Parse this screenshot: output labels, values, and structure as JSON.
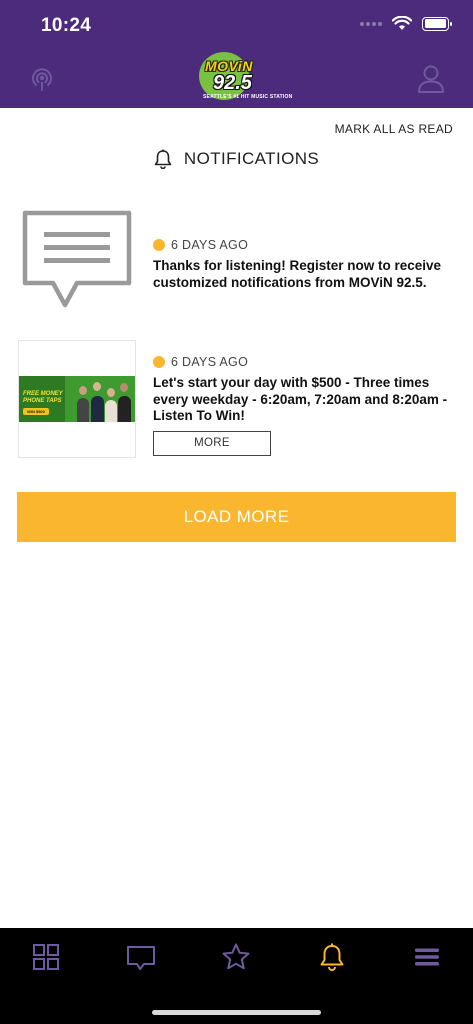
{
  "status_bar": {
    "time": "10:24"
  },
  "header": {
    "logo": {
      "name": "MOViN",
      "frequency": "92.5",
      "tagline": "SEATTLE'S #1 HIT MUSIC STATION"
    },
    "left_icon": "podcast-icon",
    "right_icon": "profile-icon"
  },
  "page": {
    "mark_all_label": "MARK ALL AS READ",
    "title": "NOTIFICATIONS",
    "title_icon": "bell-icon"
  },
  "notifications": [
    {
      "time": "6 DAYS AGO",
      "text": "Thanks for listening! Register now to receive customized notifications from MOViN 92.5.",
      "thumbnail": "message-icon"
    },
    {
      "time": "6 DAYS AGO",
      "text": "Let's start your day with $500 - Three times every weekday - 6:20am, 7:20am and 8:20am - Listen To Win!",
      "thumbnail": "promo-banner",
      "banner": {
        "line1": "FREE MONEY",
        "line2": "PHONE TAPS",
        "badge": "WIN $500"
      },
      "more_label": "MORE"
    }
  ],
  "load_more_label": "LOAD MORE",
  "tabbar": {
    "items": [
      {
        "icon": "grid-icon",
        "active": false
      },
      {
        "icon": "chat-icon",
        "active": false
      },
      {
        "icon": "star-icon",
        "active": false
      },
      {
        "icon": "bell-icon",
        "active": true
      },
      {
        "icon": "menu-icon",
        "active": false
      }
    ]
  },
  "colors": {
    "header_bg": "#4c2a7c",
    "accent": "#fbb62f",
    "tab_inactive": "#6e5a9c",
    "tabbar_bg": "#000000"
  }
}
